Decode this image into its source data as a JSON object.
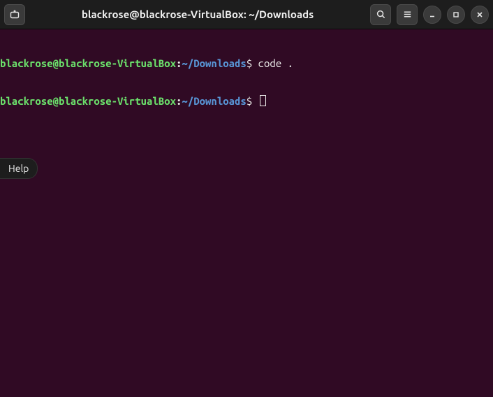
{
  "titlebar": {
    "title": "blackrose@blackrose-VirtualBox: ~/Downloads"
  },
  "prompt": {
    "user_host": "blackrose@blackrose-VirtualBox",
    "separator": ":",
    "path": "~/Downloads",
    "symbol": "$"
  },
  "lines": [
    {
      "command": " code ."
    },
    {
      "command": " "
    }
  ],
  "tooltip": {
    "help": "Help"
  }
}
